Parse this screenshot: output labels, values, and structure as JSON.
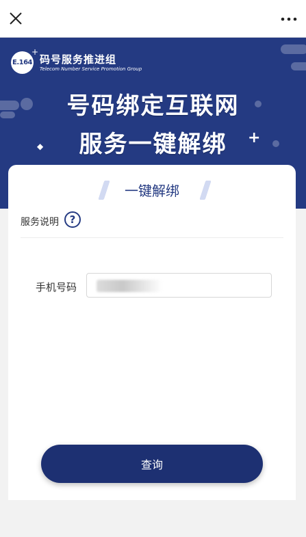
{
  "header": {
    "close_icon": "close-icon",
    "more_icon": "more-icon"
  },
  "banner": {
    "logo_mark": "E.164",
    "logo_title": "码号服务推进组",
    "logo_subtitle": "Telecom Number Service Promotion Group",
    "headline_line1": "号码绑定互联网",
    "headline_line2": "服务一键解绑",
    "background_color": "#243a82"
  },
  "card": {
    "title": "一键解绑",
    "service_label": "服务说明",
    "help_icon": "?",
    "phone_label": "手机号码",
    "phone_value": "",
    "query_label": "查询",
    "accent_color": "#1d3072"
  }
}
